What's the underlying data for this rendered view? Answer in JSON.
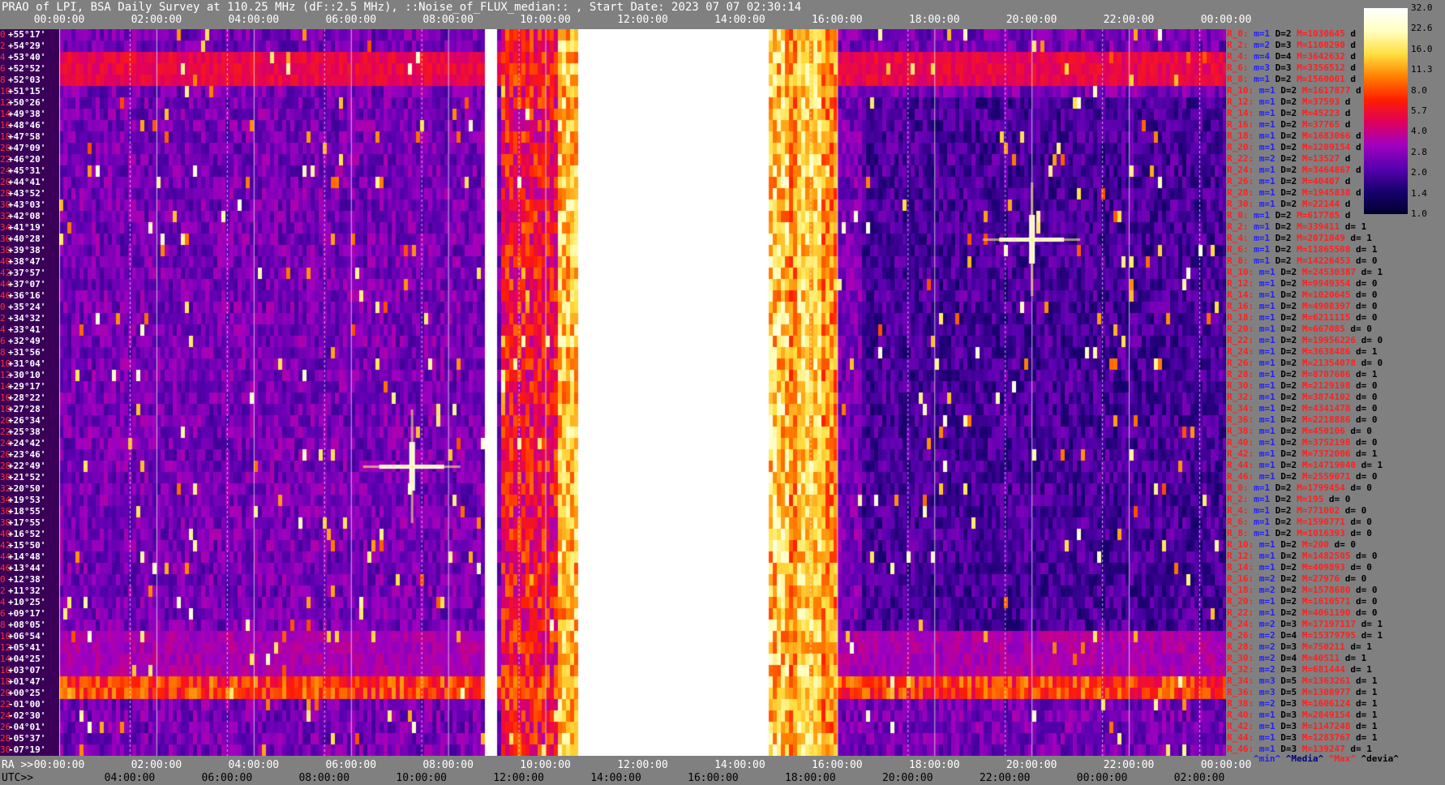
{
  "title": "PRAO of LPI, BSA Daily Survey at 110.25 MHz (dF::2.5 MHz), ::Noise_of_FLUX_median:: , Start Date: 2023 07 07 02:30:14",
  "chart_data": {
    "type": "heatmap",
    "title": "PRAO of LPI, BSA Daily Survey at 110.25 MHz (dF::2.5 MHz), ::Noise_of_FLUX_median:: , Start Date: 2023 07 07 02:30:14",
    "x_top_ticks": [
      "00:00:00",
      "02:00:00",
      "04:00:00",
      "06:00:00",
      "08:00:00",
      "10:00:00",
      "12:00:00",
      "14:00:00",
      "16:00:00",
      "18:00:00",
      "20:00:00",
      "22:00:00",
      "00:00:00"
    ],
    "x_ra_ticks": [
      "00:00:00",
      "02:00:00",
      "04:00:00",
      "06:00:00",
      "08:00:00",
      "10:00:00",
      "12:00:00",
      "14:00:00",
      "16:00:00",
      "18:00:00",
      "20:00:00",
      "22:00:00",
      "00:00:00"
    ],
    "x_utc_ticks": [
      "04:00:00",
      "06:00:00",
      "08:00:00",
      "10:00:00",
      "12:00:00",
      "14:00:00",
      "16:00:00",
      "18:00:00",
      "20:00:00",
      "22:00:00",
      "00:00:00",
      "02:00:00"
    ],
    "ra_label": "RA >>",
    "utc_label": "UTC>>",
    "dec_rows": [
      {
        "i": "0",
        "d": "+55°17'"
      },
      {
        "i": "2",
        "d": "+54°29'"
      },
      {
        "i": "4",
        "d": "+53°40'"
      },
      {
        "i": "6",
        "d": "+52°52'"
      },
      {
        "i": "8",
        "d": "+52°03'"
      },
      {
        "i": "10",
        "d": "+51°15'"
      },
      {
        "i": "12",
        "d": "+50°26'"
      },
      {
        "i": "14",
        "d": "+49°38'"
      },
      {
        "i": "16",
        "d": "+48°46'"
      },
      {
        "i": "18",
        "d": "+47°58'"
      },
      {
        "i": "20",
        "d": "+47°09'"
      },
      {
        "i": "22",
        "d": "+46°20'"
      },
      {
        "i": "24",
        "d": "+45°31'"
      },
      {
        "i": "26",
        "d": "+44°41'"
      },
      {
        "i": "28",
        "d": "+43°52'"
      },
      {
        "i": "30",
        "d": "+43°03'"
      },
      {
        "i": "32",
        "d": "+42°08'"
      },
      {
        "i": "34",
        "d": "+41°19'"
      },
      {
        "i": "36",
        "d": "+40°28'"
      },
      {
        "i": "38",
        "d": "+39°38'"
      },
      {
        "i": "40",
        "d": "+38°47'"
      },
      {
        "i": "42",
        "d": "+37°57'"
      },
      {
        "i": "44",
        "d": "+37°07'"
      },
      {
        "i": "46",
        "d": "+36°16'"
      },
      {
        "i": "0",
        "d": "+35°24'"
      },
      {
        "i": "2",
        "d": "+34°32'"
      },
      {
        "i": "4",
        "d": "+33°41'"
      },
      {
        "i": "6",
        "d": "+32°49'"
      },
      {
        "i": "8",
        "d": "+31°56'"
      },
      {
        "i": "10",
        "d": "+31°04'"
      },
      {
        "i": "12",
        "d": "+30°10'"
      },
      {
        "i": "14",
        "d": "+29°17'"
      },
      {
        "i": "16",
        "d": "+28°22'"
      },
      {
        "i": "18",
        "d": "+27°28'"
      },
      {
        "i": "20",
        "d": "+26°34'"
      },
      {
        "i": "22",
        "d": "+25°38'"
      },
      {
        "i": "24",
        "d": "+24°42'"
      },
      {
        "i": "26",
        "d": "+23°46'"
      },
      {
        "i": "28",
        "d": "+22°49'"
      },
      {
        "i": "30",
        "d": "+21°52'"
      },
      {
        "i": "32",
        "d": "+20°50'"
      },
      {
        "i": "34",
        "d": "+19°53'"
      },
      {
        "i": "36",
        "d": "+18°55'"
      },
      {
        "i": "38",
        "d": "+17°55'"
      },
      {
        "i": "40",
        "d": "+16°52'"
      },
      {
        "i": "42",
        "d": "+15°50'"
      },
      {
        "i": "44",
        "d": "+14°48'"
      },
      {
        "i": "46",
        "d": "+13°44'"
      },
      {
        "i": "0",
        "d": "+12°38'"
      },
      {
        "i": "2",
        "d": "+11°32'"
      },
      {
        "i": "4",
        "d": "+10°25'"
      },
      {
        "i": "6",
        "d": "+09°17'"
      },
      {
        "i": "8",
        "d": "+08°05'"
      },
      {
        "i": "10",
        "d": "+06°54'"
      },
      {
        "i": "12",
        "d": "+05°41'"
      },
      {
        "i": "14",
        "d": "+04°25'"
      },
      {
        "i": "16",
        "d": "+03°07'"
      },
      {
        "i": "18",
        "d": "+01°47'"
      },
      {
        "i": "20",
        "d": "+00°25'"
      },
      {
        "i": "22",
        "d": "-01°00'"
      },
      {
        "i": "24",
        "d": "-02°30'"
      },
      {
        "i": "26",
        "d": "-04°01'"
      },
      {
        "i": "28",
        "d": "-05°37'"
      },
      {
        "i": "30",
        "d": "-07°19'"
      }
    ],
    "stats_rows": [
      {
        "r": "R_0:",
        "m": "m=1",
        "D": "D=2",
        "M": "M=1030645",
        "d": "d"
      },
      {
        "r": "R_2:",
        "m": "m=2",
        "D": "D=3",
        "M": "M=1100290",
        "d": "d"
      },
      {
        "r": "R_4:",
        "m": "m=4",
        "D": "D=4",
        "M": "M=3642632",
        "d": "d"
      },
      {
        "r": "R_6:",
        "m": "m=3",
        "D": "D=3",
        "M": "M=3356512",
        "d": "d"
      },
      {
        "r": "R_8:",
        "m": "m=1",
        "D": "D=2",
        "M": "M=1560001",
        "d": "d"
      },
      {
        "r": "R_10:",
        "m": "m=1",
        "D": "D=2",
        "M": "M=1617877",
        "d": "d"
      },
      {
        "r": "R_12:",
        "m": "m=1",
        "D": "D=2",
        "M": "M=37593",
        "d": "d"
      },
      {
        "r": "R_14:",
        "m": "m=1",
        "D": "D=2",
        "M": "M=45223",
        "d": "d"
      },
      {
        "r": "R_16:",
        "m": "m=1",
        "D": "D=2",
        "M": "M=37765",
        "d": "d"
      },
      {
        "r": "R_18:",
        "m": "m=1",
        "D": "D=2",
        "M": "M=1683066",
        "d": "d"
      },
      {
        "r": "R_20:",
        "m": "m=1",
        "D": "D=2",
        "M": "M=1209154",
        "d": "d"
      },
      {
        "r": "R_22:",
        "m": "m=2",
        "D": "D=2",
        "M": "M=13527",
        "d": "d"
      },
      {
        "r": "R_24:",
        "m": "m=1",
        "D": "D=2",
        "M": "M=3464867",
        "d": "d"
      },
      {
        "r": "R_26:",
        "m": "m=1",
        "D": "D=2",
        "M": "M=40407",
        "d": "d"
      },
      {
        "r": "R_28:",
        "m": "m=1",
        "D": "D=2",
        "M": "M=1945838",
        "d": "d"
      },
      {
        "r": "R_30:",
        "m": "m=1",
        "D": "D=2",
        "M": "M=22144",
        "d": "d"
      },
      {
        "r": "R_0:",
        "m": "m=1",
        "D": "D=2",
        "M": "M=617785",
        "d": "d"
      },
      {
        "r": "R_2:",
        "m": "m=1",
        "D": "D=2",
        "M": "M=339411",
        "d": "d= 1"
      },
      {
        "r": "R_4:",
        "m": "m=1",
        "D": "D=2",
        "M": "M=2071049",
        "d": "d= 1"
      },
      {
        "r": "R_6:",
        "m": "m=1",
        "D": "D=2",
        "M": "M=11865508",
        "d": "d= 1"
      },
      {
        "r": "R_8:",
        "m": "m=1",
        "D": "D=2",
        "M": "M=14226453",
        "d": "d= 0"
      },
      {
        "r": "R_10:",
        "m": "m=1",
        "D": "D=2",
        "M": "M=24530387",
        "d": "d= 1"
      },
      {
        "r": "R_12:",
        "m": "m=1",
        "D": "D=2",
        "M": "M=9949354",
        "d": "d= 0"
      },
      {
        "r": "R_14:",
        "m": "m=1",
        "D": "D=2",
        "M": "M=1020645",
        "d": "d= 0"
      },
      {
        "r": "R_16:",
        "m": "m=1",
        "D": "D=2",
        "M": "M=4908397",
        "d": "d= 0"
      },
      {
        "r": "R_18:",
        "m": "m=1",
        "D": "D=2",
        "M": "M=6211115",
        "d": "d= 0"
      },
      {
        "r": "R_20:",
        "m": "m=1",
        "D": "D=2",
        "M": "M=667085",
        "d": "d= 0"
      },
      {
        "r": "R_22:",
        "m": "m=1",
        "D": "D=2",
        "M": "M=19956226",
        "d": "d= 0"
      },
      {
        "r": "R_24:",
        "m": "m=1",
        "D": "D=2",
        "M": "M=3638486",
        "d": "d= 1"
      },
      {
        "r": "R_26:",
        "m": "m=1",
        "D": "D=2",
        "M": "M=21354078",
        "d": "d= 0"
      },
      {
        "r": "R_28:",
        "m": "m=1",
        "D": "D=2",
        "M": "M=8707686",
        "d": "d= 1"
      },
      {
        "r": "R_30:",
        "m": "m=1",
        "D": "D=2",
        "M": "M=2129198",
        "d": "d= 0"
      },
      {
        "r": "R_32:",
        "m": "m=1",
        "D": "D=2",
        "M": "M=3874102",
        "d": "d= 0"
      },
      {
        "r": "R_34:",
        "m": "m=1",
        "D": "D=2",
        "M": "M=4341478",
        "d": "d= 0"
      },
      {
        "r": "R_36:",
        "m": "m=1",
        "D": "D=2",
        "M": "M=2218886",
        "d": "d= 0"
      },
      {
        "r": "R_38:",
        "m": "m=1",
        "D": "D=2",
        "M": "M=450106",
        "d": "d= 0"
      },
      {
        "r": "R_40:",
        "m": "m=1",
        "D": "D=2",
        "M": "M=3752198",
        "d": "d= 0"
      },
      {
        "r": "R_42:",
        "m": "m=1",
        "D": "D=2",
        "M": "M=7372006",
        "d": "d= 1"
      },
      {
        "r": "R_44:",
        "m": "m=1",
        "D": "D=2",
        "M": "M=14719040",
        "d": "d= 1"
      },
      {
        "r": "R_46:",
        "m": "m=1",
        "D": "D=2",
        "M": "M=2559071",
        "d": "d= 0"
      },
      {
        "r": "R_0:",
        "m": "m=1",
        "D": "D=2",
        "M": "M=1799454",
        "d": "d= 0"
      },
      {
        "r": "R_2:",
        "m": "m=1",
        "D": "D=2",
        "M": "M=195",
        "d": "d= 0"
      },
      {
        "r": "R_4:",
        "m": "m=1",
        "D": "D=2",
        "M": "M=771002",
        "d": "d= 0"
      },
      {
        "r": "R_6:",
        "m": "m=1",
        "D": "D=2",
        "M": "M=1590771",
        "d": "d= 0"
      },
      {
        "r": "R_8:",
        "m": "m=1",
        "D": "D=2",
        "M": "M=1016393",
        "d": "d= 0"
      },
      {
        "r": "R_10:",
        "m": "m=1",
        "D": "D=2",
        "M": "M=200",
        "d": "d= 0"
      },
      {
        "r": "R_12:",
        "m": "m=1",
        "D": "D=2",
        "M": "M=1482505",
        "d": "d= 0"
      },
      {
        "r": "R_14:",
        "m": "m=1",
        "D": "D=2",
        "M": "M=409893",
        "d": "d= 0"
      },
      {
        "r": "R_16:",
        "m": "m=2",
        "D": "D=2",
        "M": "M=27976",
        "d": "d= 0"
      },
      {
        "r": "R_18:",
        "m": "m=2",
        "D": "D=2",
        "M": "M=1578680",
        "d": "d= 0"
      },
      {
        "r": "R_20:",
        "m": "m=1",
        "D": "D=2",
        "M": "M=1610571",
        "d": "d= 0"
      },
      {
        "r": "R_22:",
        "m": "m=1",
        "D": "D=2",
        "M": "M=4061190",
        "d": "d= 0"
      },
      {
        "r": "R_24:",
        "m": "m=2",
        "D": "D=3",
        "M": "M=17197117",
        "d": "d= 1"
      },
      {
        "r": "R_26:",
        "m": "m=2",
        "D": "D=4",
        "M": "M=15379795",
        "d": "d= 1"
      },
      {
        "r": "R_28:",
        "m": "m=2",
        "D": "D=3",
        "M": "M=750211",
        "d": "d= 1"
      },
      {
        "r": "R_30:",
        "m": "m=2",
        "D": "D=4",
        "M": "M=40511",
        "d": "d= 1"
      },
      {
        "r": "R_32:",
        "m": "m=2",
        "D": "D=3",
        "M": "M=681444",
        "d": "d= 1"
      },
      {
        "r": "R_34:",
        "m": "m=3",
        "D": "D=5",
        "M": "M=1363261",
        "d": "d= 1"
      },
      {
        "r": "R_36:",
        "m": "m=3",
        "D": "D=5",
        "M": "M=1308977",
        "d": "d= 1"
      },
      {
        "r": "R_38:",
        "m": "m=2",
        "D": "D=3",
        "M": "M=1606124",
        "d": "d= 1"
      },
      {
        "r": "R_40:",
        "m": "m=1",
        "D": "D=3",
        "M": "M=2849154",
        "d": "d= 1"
      },
      {
        "r": "R_42:",
        "m": "m=1",
        "D": "D=3",
        "M": "M=1147248",
        "d": "d= 1"
      },
      {
        "r": "R_44:",
        "m": "m=1",
        "D": "D=3",
        "M": "M=1283767",
        "d": "d= 1"
      },
      {
        "r": "R_46:",
        "m": "m=1",
        "D": "D=3",
        "M": "M=139247",
        "d": "d= 1"
      }
    ],
    "colorbar_ticks": [
      "32.0",
      "22.6",
      "16.0",
      "11.3",
      "8.0",
      "5.7",
      "4.0",
      "2.8",
      "2.0",
      "1.4",
      "1.0"
    ],
    "colorbar_range": [
      1.0,
      32.0
    ],
    "colorbar_scale": "log",
    "legend": [
      {
        "text": "^min^",
        "color": "#2020ff"
      },
      {
        "text": "^Media^",
        "color": "#000080"
      },
      {
        "text": "^Max^",
        "color": "#ff2020"
      },
      {
        "text": "^devia^",
        "color": "#000000"
      }
    ],
    "colormap": [
      "#000030",
      "#1a0070",
      "#5a00b0",
      "#a000c0",
      "#e00060",
      "#ff2000",
      "#ff8000",
      "#ffe040",
      "#ffffc0",
      "#ffffff"
    ],
    "features": [
      {
        "kind": "saturated-band",
        "from": "10:35:00",
        "to": "14:35:00"
      },
      {
        "kind": "bright-band",
        "from": "15:05:00",
        "to": "15:55:00"
      },
      {
        "kind": "bright-column",
        "at": "08:50:00"
      },
      {
        "kind": "point-source",
        "ra": "07:15:00",
        "dec": "+22°49'"
      },
      {
        "kind": "point-source",
        "ra": "20:00:00",
        "dec": "+40°28'"
      }
    ]
  }
}
